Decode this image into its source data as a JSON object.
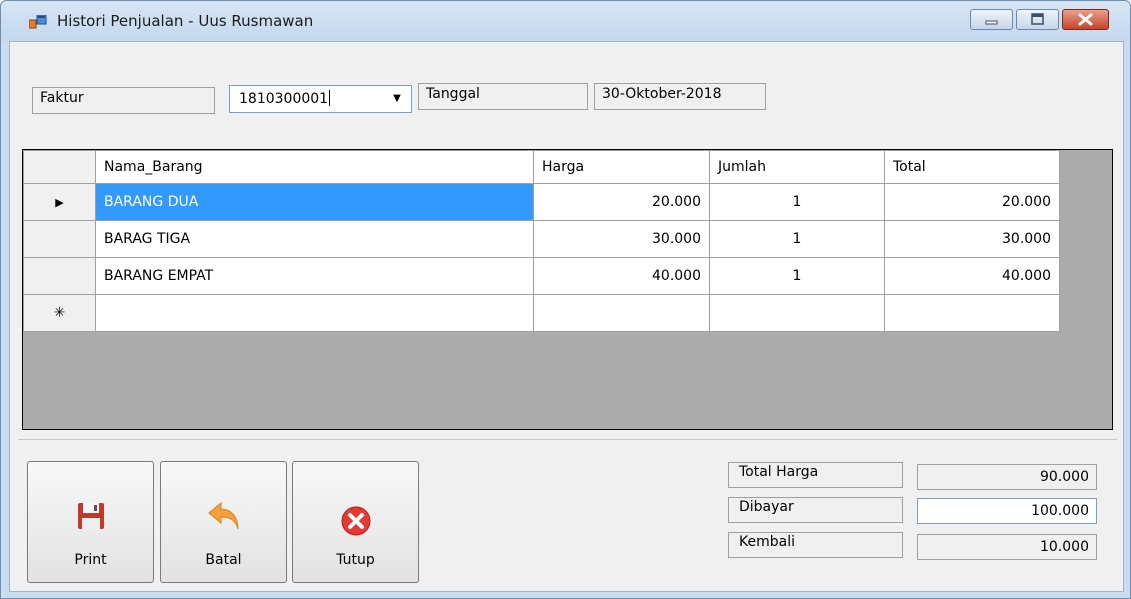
{
  "window": {
    "title": "Histori Penjualan - Uus Rusmawan",
    "icons": {
      "app": "app-window-icon",
      "minimize": "minimize-icon",
      "maximize": "maximize-icon",
      "close": "close-icon"
    }
  },
  "header": {
    "faktur_label": "Faktur",
    "faktur_value": "1810300001",
    "tanggal_label": "Tanggal",
    "tanggal_value": "30-Oktober-2018"
  },
  "grid": {
    "columns": [
      "Nama_Barang",
      "Harga",
      "Jumlah",
      "Total"
    ],
    "rows": [
      {
        "nama": "BARANG DUA",
        "harga": "20.000",
        "jumlah": "1",
        "total": "20.000"
      },
      {
        "nama": "BARAG TIGA",
        "harga": "30.000",
        "jumlah": "1",
        "total": "30.000"
      },
      {
        "nama": "BARANG EMPAT",
        "harga": "40.000",
        "jumlah": "1",
        "total": "40.000"
      }
    ],
    "current_row_marker": "▶",
    "new_row_marker": "✳"
  },
  "buttons": {
    "print": "Print",
    "batal": "Batal",
    "tutup": "Tutup"
  },
  "summary": {
    "total_harga_label": "Total Harga",
    "total_harga_value": "90.000",
    "dibayar_label": "Dibayar",
    "dibayar_value": "100.000",
    "kembali_label": "Kembali",
    "kembali_value": "10.000"
  },
  "colors": {
    "selection": "#3399ff",
    "grid_background": "#ababab",
    "window_frame": "#c9dcf0"
  }
}
